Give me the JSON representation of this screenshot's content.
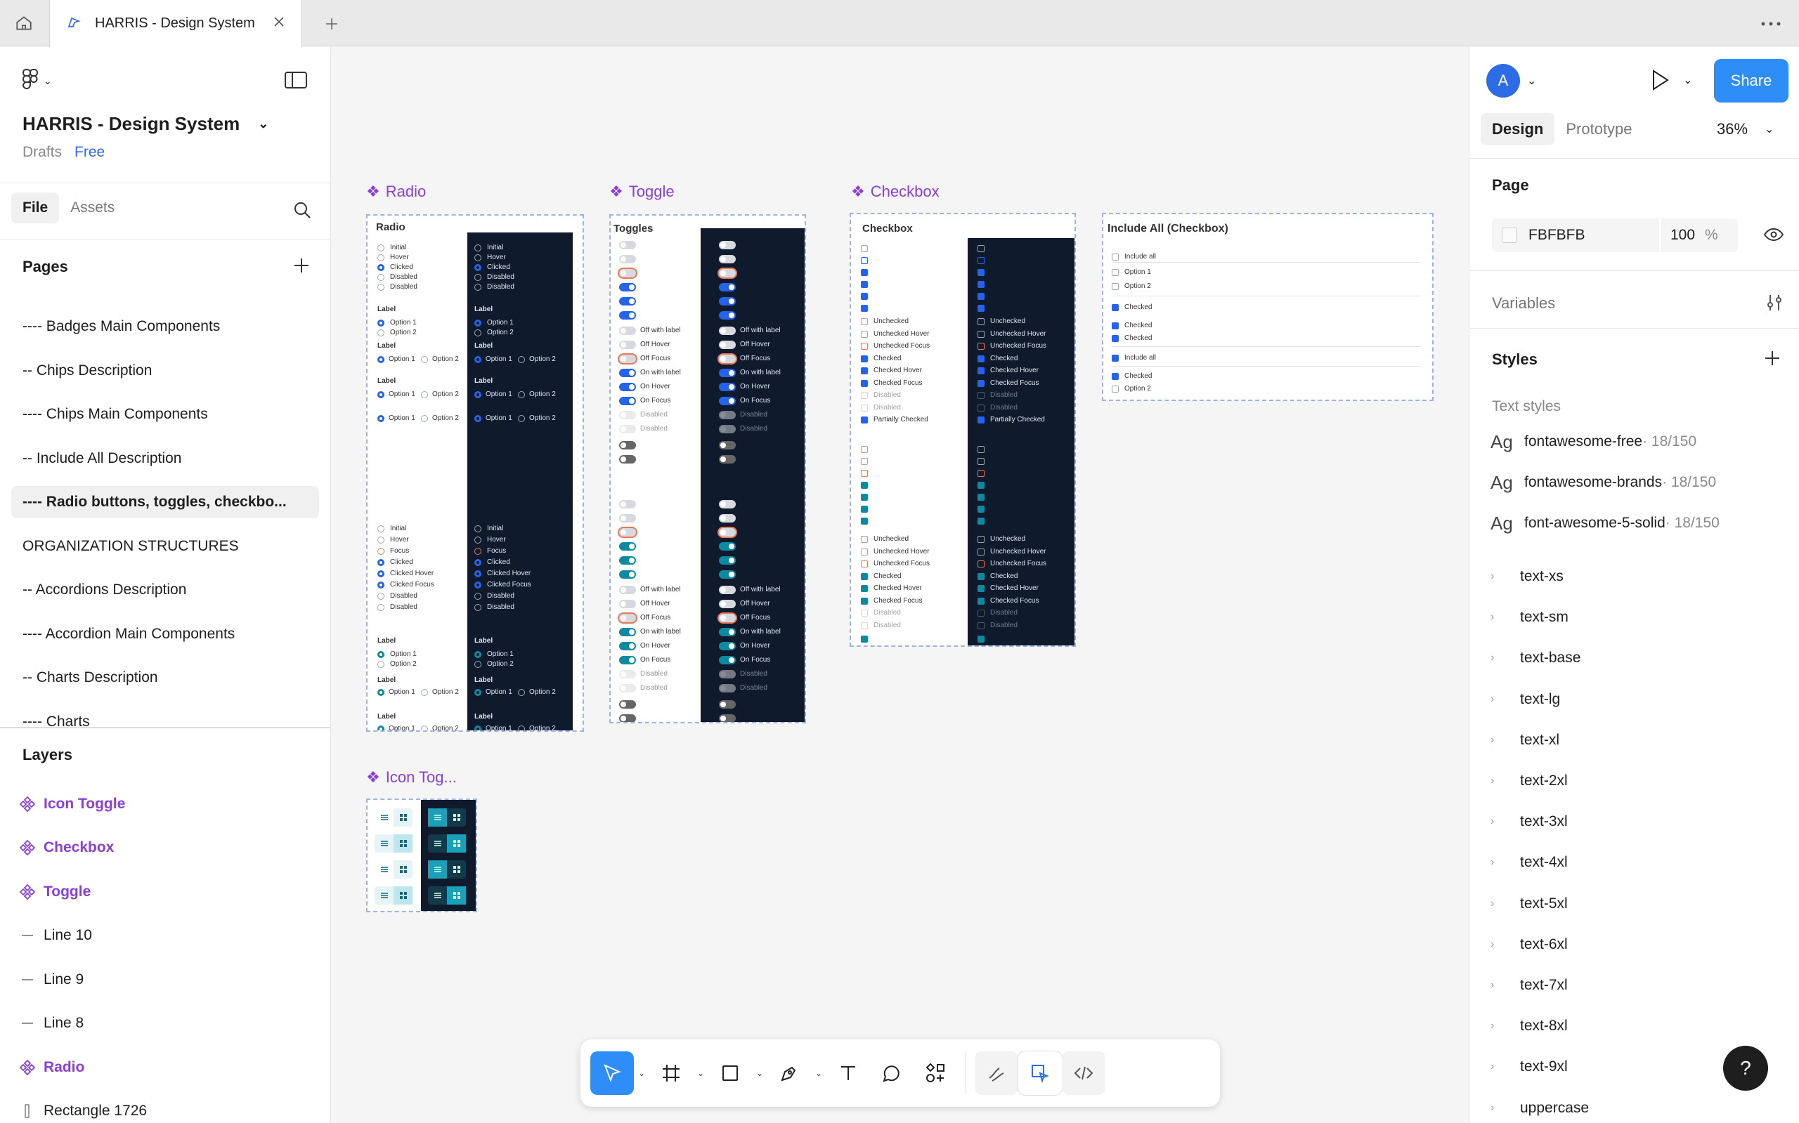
{
  "window": {
    "tab_title": "HARRIS - Design System"
  },
  "left": {
    "file_name": "HARRIS - Design System",
    "drafts": "Drafts",
    "plan": "Free",
    "tabs": [
      "File",
      "Assets"
    ],
    "pages_heading": "Pages",
    "pages": [
      "---- Badges Main Components",
      "-- Chips Description",
      "---- Chips Main Components",
      "-- Include All Description",
      "---- Radio buttons, toggles, checkbo...",
      "ORGANIZATION STRUCTURES",
      "-- Accordions Description",
      "---- Accordion Main Components",
      "-- Charts Description",
      "---- Charts"
    ],
    "layers_heading": "Layers",
    "layers": [
      {
        "name": "Icon Toggle",
        "kind": "component"
      },
      {
        "name": "Checkbox",
        "kind": "component"
      },
      {
        "name": "Toggle",
        "kind": "component"
      },
      {
        "name": "Line 10",
        "kind": "line"
      },
      {
        "name": "Line 9",
        "kind": "line"
      },
      {
        "name": "Line 8",
        "kind": "line"
      },
      {
        "name": "Radio",
        "kind": "component"
      },
      {
        "name": "Rectangle 1726",
        "kind": "rect"
      }
    ]
  },
  "right": {
    "avatar": "A",
    "share": "Share",
    "tabs": [
      "Design",
      "Prototype"
    ],
    "zoom": "36%",
    "page_heading": "Page",
    "page_color": "FBFBFB",
    "page_opacity": "100",
    "percent": "%",
    "variables": "Variables",
    "styles": "Styles",
    "text_styles": "Text styles",
    "font_styles": [
      {
        "name": "fontawesome-free",
        "meta": " · 18/150"
      },
      {
        "name": "fontawesome-brands",
        "meta": " · 18/150"
      },
      {
        "name": "font-awesome-5-solid",
        "meta": " · 18/150"
      }
    ],
    "text_style_groups": [
      "text-xs",
      "text-sm",
      "text-base",
      "text-lg",
      "text-xl",
      "text-2xl",
      "text-3xl",
      "text-4xl",
      "text-5xl",
      "text-6xl",
      "text-7xl",
      "text-8xl",
      "text-9xl",
      "uppercase"
    ]
  },
  "canvas": {
    "frames": {
      "radio": "Radio",
      "toggle": "Toggle",
      "checkbox": "Checkbox",
      "icon_toggle": "Icon Tog..."
    },
    "radio_title": "Radio",
    "toggles_title": "Toggles",
    "checkbox_title": "Checkbox",
    "include_title": "Include All (Checkbox)",
    "radio_states": [
      "Initial",
      "Hover",
      "Clicked",
      "Disabled",
      "Disabled"
    ],
    "radio_states2": [
      "Initial",
      "Hover",
      "Focus",
      "Clicked",
      "Clicked Hover",
      "Clicked Focus",
      "Disabled",
      "Disabled"
    ],
    "label": "Label",
    "option1": "Option 1",
    "option2": "Option 2",
    "toggle_states": [
      "Off with label",
      "Off Hover",
      "Off Focus",
      "On with label",
      "On Hover",
      "On Focus",
      "Disabled",
      "Disabled"
    ],
    "checkbox_states": [
      "Unchecked",
      "Unchecked Hover",
      "Unchecked Focus",
      "Checked",
      "Checked Hover",
      "Checked Focus",
      "Disabled",
      "Disabled"
    ],
    "partially": "Partially Checked",
    "include_rows": [
      "Include all",
      "Option 1",
      "Option 2",
      "Checked",
      "Checked",
      "Checked",
      "Include all",
      "Checked",
      "Option 2"
    ]
  },
  "help": "?"
}
